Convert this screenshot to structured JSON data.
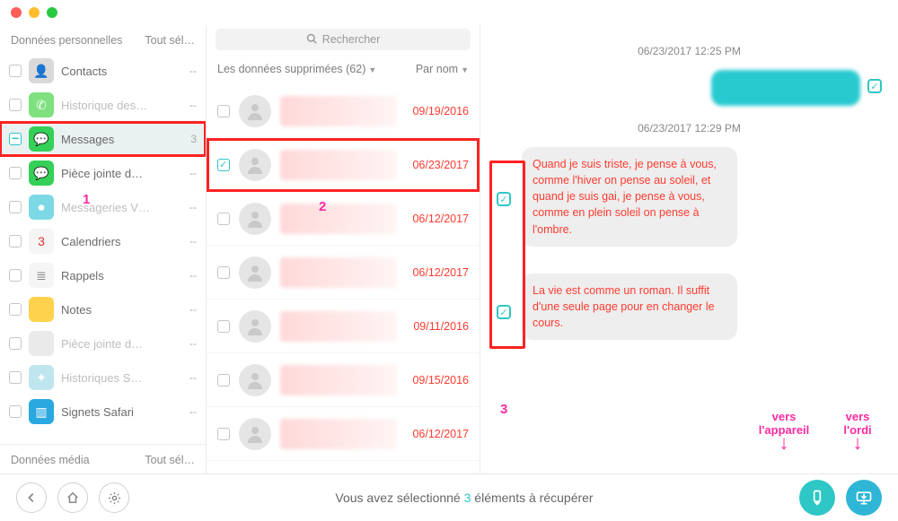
{
  "sidebar": {
    "header_left": "Données personnelles",
    "header_right": "Tout sél…",
    "media_header": "Données média",
    "items": [
      {
        "label": "Contacts",
        "count": "--",
        "icon_bg": "#d9d9d9",
        "icon_txt": "👤",
        "muted": false,
        "checked": false
      },
      {
        "label": "Historique des…",
        "count": "--",
        "icon_bg": "#7ee07e",
        "icon_txt": "✆",
        "muted": true,
        "checked": false
      },
      {
        "label": "Messages",
        "count": "3",
        "icon_bg": "#34d058",
        "icon_txt": "💬",
        "muted": false,
        "checked": true,
        "selected": true,
        "highlight": true
      },
      {
        "label": "Pièce jointe d…",
        "count": "--",
        "icon_bg": "#34d058",
        "icon_txt": "💬",
        "muted": false,
        "checked": false
      },
      {
        "label": "Messageries V…",
        "count": "--",
        "icon_bg": "#7dd8e6",
        "icon_txt": "⏺",
        "muted": true,
        "checked": false
      },
      {
        "label": "Calendriers",
        "count": "--",
        "icon_bg": "#f5f5f5",
        "icon_txt": "3",
        "muted": false,
        "checked": false,
        "icon_color": "#d33"
      },
      {
        "label": "Rappels",
        "count": "--",
        "icon_bg": "#f5f5f5",
        "icon_txt": "≣",
        "muted": false,
        "checked": false,
        "icon_color": "#888"
      },
      {
        "label": "Notes",
        "count": "--",
        "icon_bg": "#ffd24d",
        "icon_txt": "",
        "muted": false,
        "checked": false
      },
      {
        "label": "Pièce jointe d…",
        "count": "--",
        "icon_bg": "#eaeaea",
        "icon_txt": "",
        "muted": true,
        "checked": false
      },
      {
        "label": "Historiques S…",
        "count": "--",
        "icon_bg": "#bfe6ef",
        "icon_txt": "✦",
        "muted": true,
        "checked": false
      },
      {
        "label": "Signets Safari",
        "count": "--",
        "icon_bg": "#2aa8e0",
        "icon_txt": "▥",
        "muted": false,
        "checked": false
      }
    ]
  },
  "middle": {
    "search_placeholder": "Rechercher",
    "filter_label": "Les données supprimées (62)",
    "sort_label": "Par nom",
    "items": [
      {
        "date": "09/19/2016",
        "checked": false
      },
      {
        "date": "06/23/2017",
        "checked": true,
        "highlight": true
      },
      {
        "date": "06/12/2017",
        "checked": false
      },
      {
        "date": "06/12/2017",
        "checked": false
      },
      {
        "date": "09/11/2016",
        "checked": false
      },
      {
        "date": "09/15/2016",
        "checked": false
      },
      {
        "date": "06/12/2017",
        "checked": false
      }
    ]
  },
  "conversation": {
    "ts1": "06/23/2017  12:25 PM",
    "ts2": "06/23/2017  12:29 PM",
    "out_hidden": "████████████████",
    "in1": "Quand je suis triste, je pense à vous, comme l'hiver on pense au soleil, et quand je suis gai, je pense à vous, comme en plein soleil on pense à l'ombre.",
    "in2": "La vie est comme un roman. Il suffit d'une seule page pour en changer le cours."
  },
  "footer": {
    "text_pre": "Vous avez sélectionné ",
    "count": "3",
    "text_post": " éléments à récupérer"
  },
  "annotations": {
    "n1": "1",
    "n2": "2",
    "n3": "3",
    "to_device": "vers l'appareil",
    "to_computer": "vers l'ordi"
  }
}
